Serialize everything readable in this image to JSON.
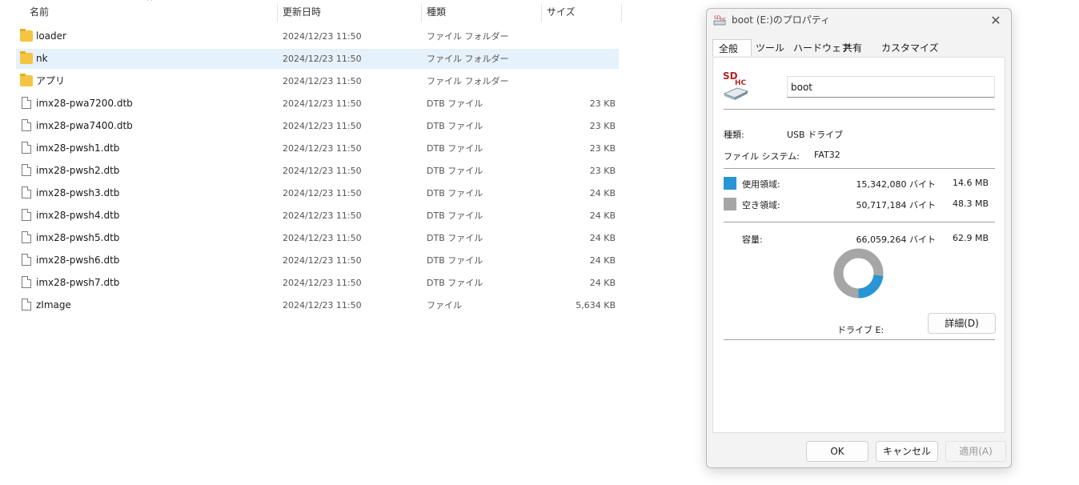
{
  "explorer": {
    "columns": {
      "name": "名前",
      "date": "更新日時",
      "type": "種類",
      "size": "サイズ"
    },
    "rows": [
      {
        "name": "loader",
        "date": "2024/12/23 11:50",
        "type": "ファイル フォルダー",
        "size": "",
        "icon": "folder-icon",
        "selected": false
      },
      {
        "name": "nk",
        "date": "2024/12/23 11:50",
        "type": "ファイル フォルダー",
        "size": "",
        "icon": "folder-icon",
        "selected": true
      },
      {
        "name": "アプリ",
        "date": "2024/12/23 11:50",
        "type": "ファイル フォルダー",
        "size": "",
        "icon": "folder-icon",
        "selected": false
      },
      {
        "name": "imx28-pwa7200.dtb",
        "date": "2024/12/23 11:50",
        "type": "DTB ファイル",
        "size": "23 KB",
        "icon": "file-icon",
        "selected": false
      },
      {
        "name": "imx28-pwa7400.dtb",
        "date": "2024/12/23 11:50",
        "type": "DTB ファイル",
        "size": "23 KB",
        "icon": "file-icon",
        "selected": false
      },
      {
        "name": "imx28-pwsh1.dtb",
        "date": "2024/12/23 11:50",
        "type": "DTB ファイル",
        "size": "23 KB",
        "icon": "file-icon",
        "selected": false
      },
      {
        "name": "imx28-pwsh2.dtb",
        "date": "2024/12/23 11:50",
        "type": "DTB ファイル",
        "size": "23 KB",
        "icon": "file-icon",
        "selected": false
      },
      {
        "name": "imx28-pwsh3.dtb",
        "date": "2024/12/23 11:50",
        "type": "DTB ファイル",
        "size": "24 KB",
        "icon": "file-icon",
        "selected": false
      },
      {
        "name": "imx28-pwsh4.dtb",
        "date": "2024/12/23 11:50",
        "type": "DTB ファイル",
        "size": "24 KB",
        "icon": "file-icon",
        "selected": false
      },
      {
        "name": "imx28-pwsh5.dtb",
        "date": "2024/12/23 11:50",
        "type": "DTB ファイル",
        "size": "24 KB",
        "icon": "file-icon",
        "selected": false
      },
      {
        "name": "imx28-pwsh6.dtb",
        "date": "2024/12/23 11:50",
        "type": "DTB ファイル",
        "size": "24 KB",
        "icon": "file-icon",
        "selected": false
      },
      {
        "name": "imx28-pwsh7.dtb",
        "date": "2024/12/23 11:50",
        "type": "DTB ファイル",
        "size": "24 KB",
        "icon": "file-icon",
        "selected": false
      },
      {
        "name": "zImage",
        "date": "2024/12/23 11:50",
        "type": "ファイル",
        "size": "5,634 KB",
        "icon": "file-icon",
        "selected": false
      }
    ]
  },
  "dialog": {
    "title": "boot (E:)のプロパティ",
    "tabs": [
      "全般",
      "ツール",
      "ハードウェア",
      "共有",
      "カスタマイズ"
    ],
    "active_tab": 0,
    "drive_label_value": "boot",
    "drive_icon_text": {
      "top": "SD",
      "sub": "HC"
    },
    "type_label": "種類:",
    "type_value": "USB ドライブ",
    "fs_label": "ファイル システム:",
    "fs_value": "FAT32",
    "used_label": "使用領域:",
    "used_bytes": "15,342,080 バイト",
    "used_size": "14.6 MB",
    "free_label": "空き領域:",
    "free_bytes": "50,717,184 バイト",
    "free_size": "48.3 MB",
    "capacity_label": "容量:",
    "capacity_bytes": "66,059,264 バイト",
    "capacity_size": "62.9 MB",
    "drive_caption": "ドライブ E:",
    "details_button": "詳細(D)",
    "ok_button": "OK",
    "cancel_button": "キャンセル",
    "apply_button": "適用(A)",
    "used_fraction": 0.2323,
    "colors": {
      "used": "#2896d6",
      "free": "#a6a6a6"
    }
  }
}
